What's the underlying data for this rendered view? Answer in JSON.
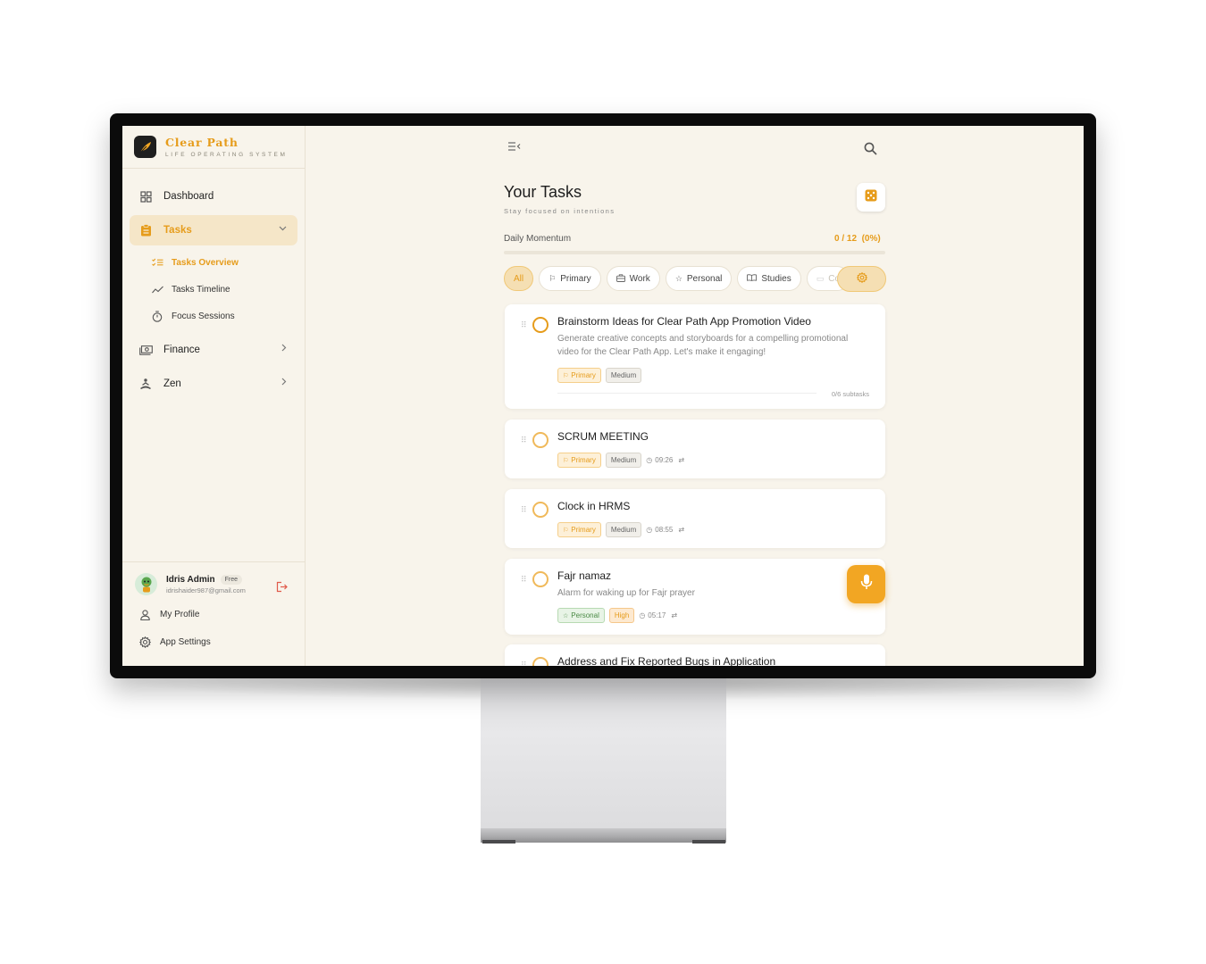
{
  "brand": {
    "name": "Clear Path",
    "tagline": "LIFE OPERATING SYSTEM"
  },
  "sidebar": {
    "items": [
      {
        "label": "Dashboard",
        "icon": "grid-icon"
      },
      {
        "label": "Tasks",
        "icon": "clipboard-icon",
        "active": true,
        "expanded": true
      },
      {
        "label": "Finance",
        "icon": "cash-icon"
      },
      {
        "label": "Zen",
        "icon": "meditation-icon"
      }
    ],
    "tasks_sub": [
      {
        "label": "Tasks Overview",
        "icon": "checklist-icon",
        "active": true
      },
      {
        "label": "Tasks Timeline",
        "icon": "trend-icon"
      },
      {
        "label": "Focus Sessions",
        "icon": "timer-icon"
      }
    ]
  },
  "user": {
    "name": "Idris Admin",
    "plan": "Free",
    "email": "idrishaider987@gmail.com"
  },
  "footer_links": {
    "profile": "My Profile",
    "settings": "App Settings"
  },
  "page": {
    "title": "Your Tasks",
    "subtitle": "Stay focused on intentions"
  },
  "momentum": {
    "label": "Daily Momentum",
    "value_text": "0 / 12  (0%)",
    "fraction": 0
  },
  "filters": [
    {
      "label": "All",
      "active": true
    },
    {
      "label": "Primary",
      "icon": "flag-icon"
    },
    {
      "label": "Work",
      "icon": "briefcase-icon"
    },
    {
      "label": "Personal",
      "icon": "star-icon"
    },
    {
      "label": "Studies",
      "icon": "book-icon"
    },
    {
      "label": "Co",
      "icon": "laptop-icon"
    }
  ],
  "tasks": [
    {
      "title": "Brainstorm Ideas for Clear Path App Promotion Video",
      "description": "Generate creative concepts and storyboards for a compelling promotional video for the Clear Path App. Let's make it engaging!",
      "category": "Primary",
      "priority": "Medium",
      "subtasks": "0/6 subtasks"
    },
    {
      "title": "SCRUM MEETING",
      "category": "Primary",
      "priority": "Medium",
      "time": "09:26"
    },
    {
      "title": "Clock in HRMS",
      "category": "Primary",
      "priority": "Medium",
      "time": "08:55"
    },
    {
      "title": "Fajr namaz",
      "description": "Alarm for waking up for Fajr prayer",
      "category": "Personal",
      "priority": "High",
      "time": "05:17"
    },
    {
      "title": "Address and Fix Reported Bugs in Application"
    }
  ],
  "colors": {
    "accent": "#e69c1b",
    "background": "#f8f4eb"
  }
}
